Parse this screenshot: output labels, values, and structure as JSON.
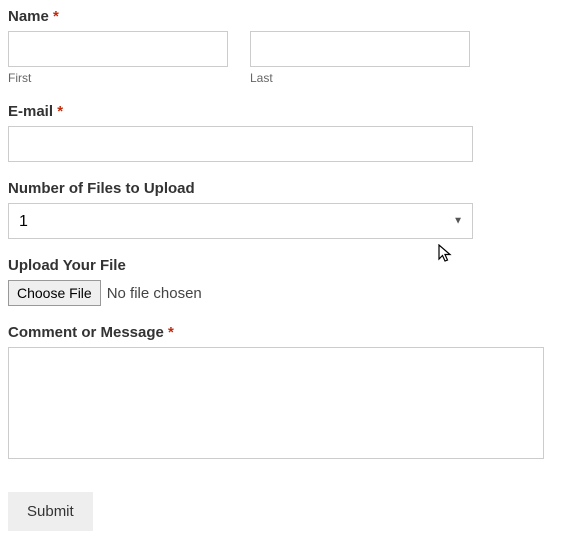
{
  "form": {
    "name": {
      "label": "Name",
      "required_marker": "*",
      "first_value": "",
      "last_value": "",
      "first_sublabel": "First",
      "last_sublabel": "Last"
    },
    "email": {
      "label": "E-mail",
      "required_marker": "*",
      "value": ""
    },
    "num_files": {
      "label": "Number of Files to Upload",
      "selected": "1"
    },
    "upload": {
      "label": "Upload Your File",
      "button_label": "Choose File",
      "status": "No file chosen"
    },
    "comment": {
      "label": "Comment or Message",
      "required_marker": "*",
      "value": ""
    },
    "submit_label": "Submit"
  }
}
